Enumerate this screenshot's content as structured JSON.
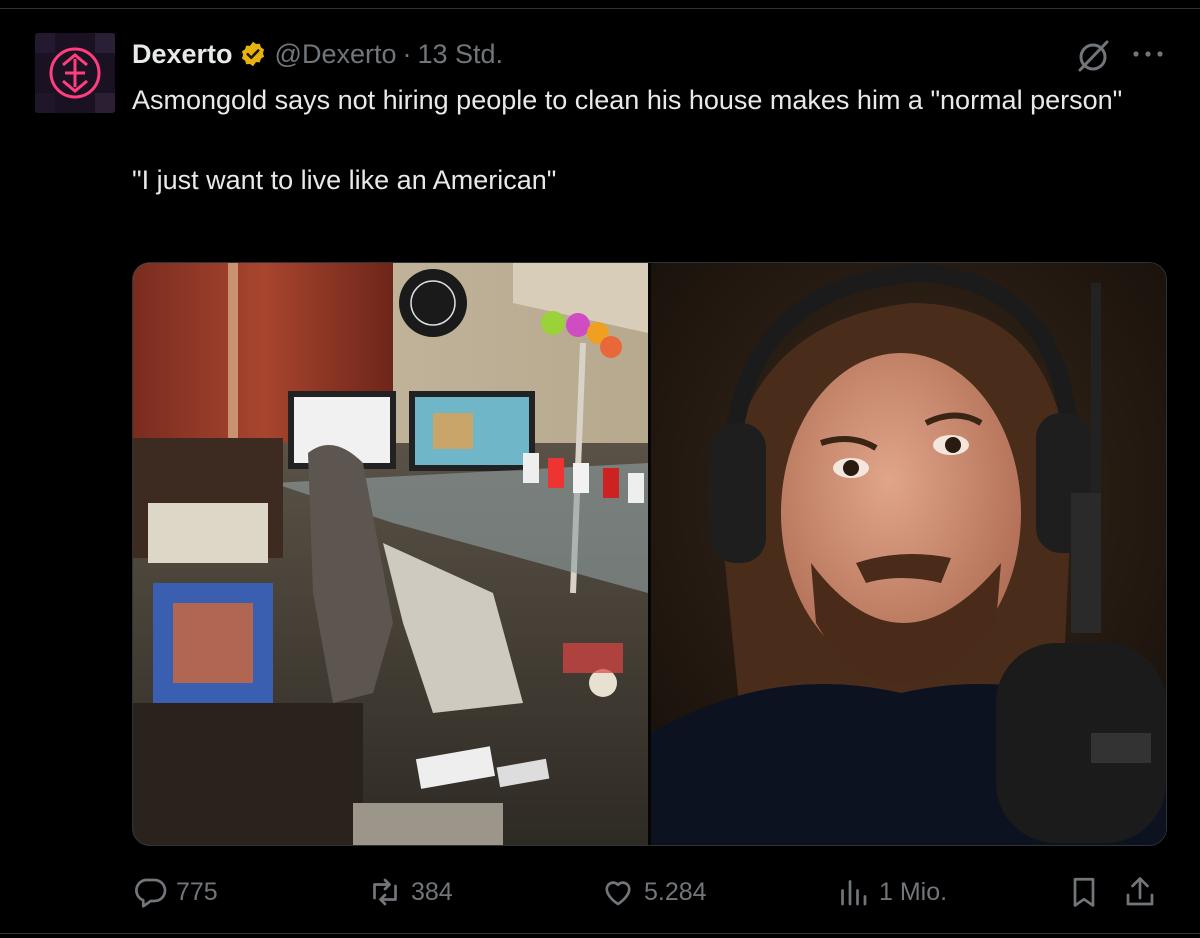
{
  "tweet": {
    "author_name": "Dexerto",
    "handle": "@Dexerto",
    "separator": "·",
    "timestamp": "13 Std.",
    "text_line1": "Asmongold says not hiring people to clean his house makes him a \"normal person\"",
    "text_line2": "\"I just want to live like an American\""
  },
  "metrics": {
    "replies": "775",
    "reposts": "384",
    "likes": "5.284",
    "views": "1 Mio."
  },
  "icons": {
    "verified": "verified-badge-icon",
    "grok": "grok-icon",
    "more": "more-icon",
    "reply": "reply-icon",
    "repost": "repost-icon",
    "like": "heart-icon",
    "views": "views-icon",
    "bookmark": "bookmark-icon",
    "share": "share-icon"
  },
  "colors": {
    "background": "#000000",
    "text": "#e7e9ea",
    "secondary": "#71767b",
    "verified_gold": "#e8b20d",
    "brand_pink": "#ff3d7f"
  }
}
